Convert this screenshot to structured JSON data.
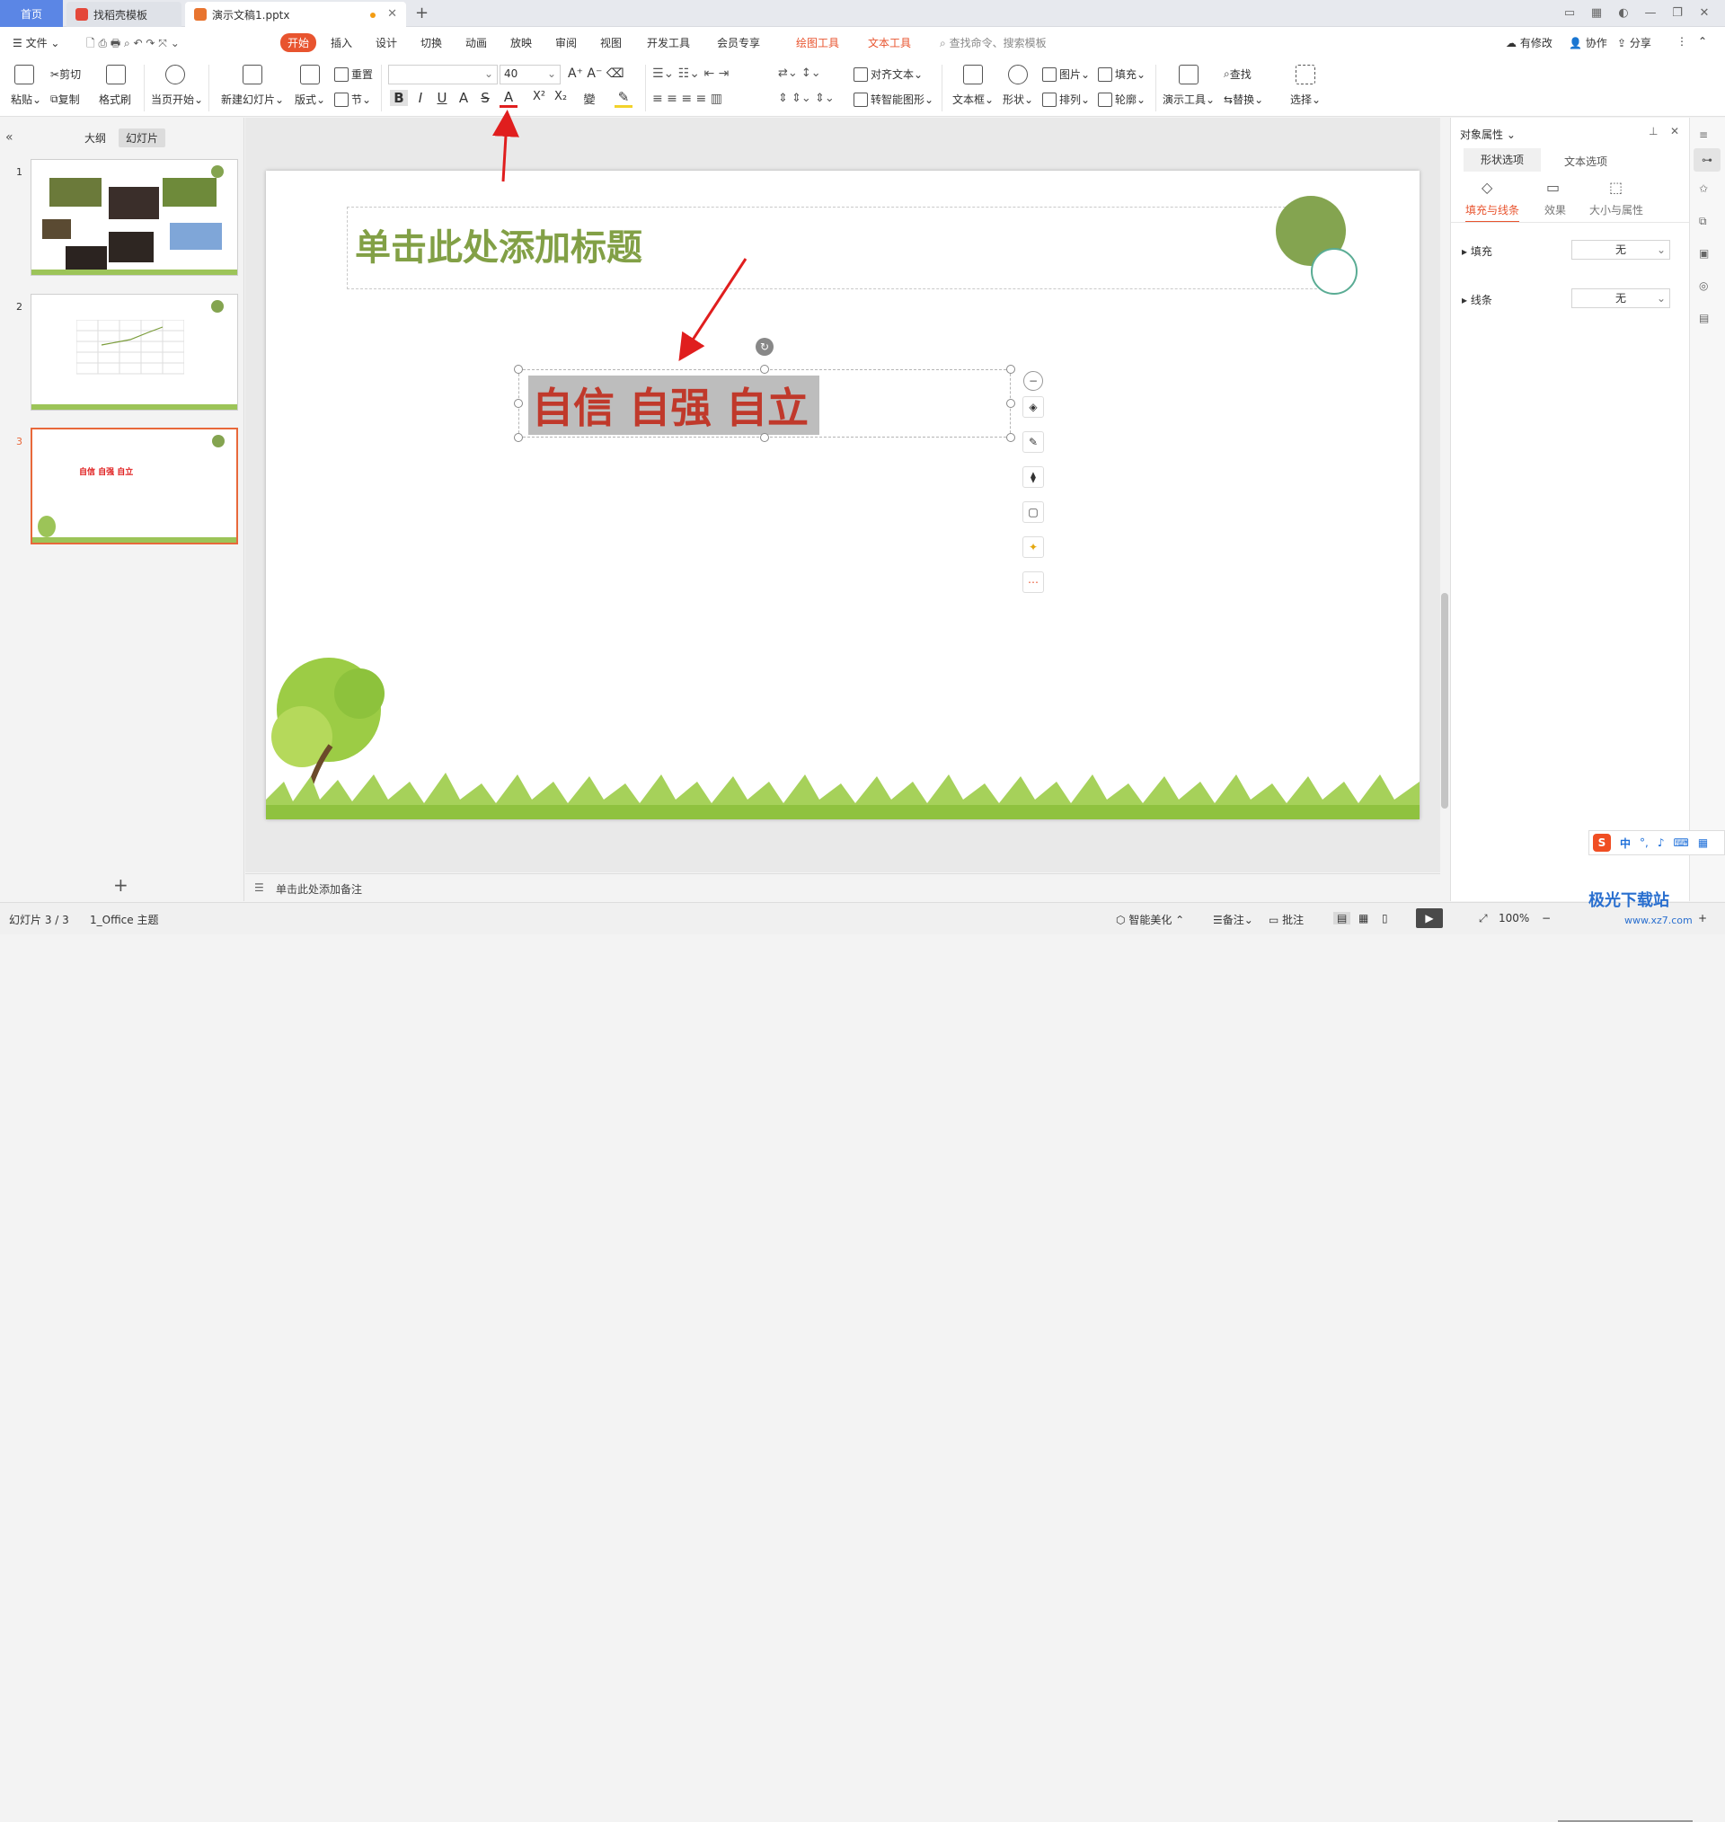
{
  "tabs": {
    "home": "首页",
    "template": "找稻壳模板",
    "doc": "演示文稿1.pptx"
  },
  "menu": {
    "file": "文件",
    "items": [
      "开始",
      "插入",
      "设计",
      "切换",
      "动画",
      "放映",
      "审阅",
      "视图",
      "开发工具",
      "会员专享"
    ],
    "drawing_tools": "绘图工具",
    "text_tools": "文本工具",
    "search_placeholder": "查找命令、搜索模板",
    "has_changes": "有修改",
    "collab": "协作",
    "share": "分享"
  },
  "ribbon": {
    "paste": "粘贴",
    "cut": "剪切",
    "copy": "复制",
    "format_painter": "格式刷",
    "from_current": "当页开始",
    "new_slide": "新建幻灯片",
    "layout": "版式",
    "section": "节",
    "reset": "重置",
    "font_size": "40",
    "align_text": "对齐文本",
    "smartart": "转智能图形",
    "textbox": "文本框",
    "shape": "形状",
    "picture": "图片",
    "arrange": "排列",
    "fill": "填充",
    "outline": "轮廓",
    "present_tools": "演示工具",
    "find": "查找",
    "replace": "替换",
    "select": "选择"
  },
  "left": {
    "outline_tab": "大纲",
    "slides_tab": "幻灯片",
    "slide_numbers": [
      "1",
      "2",
      "3"
    ],
    "thumb3_text": "自信 自强 自立"
  },
  "slide": {
    "title_placeholder": "单击此处添加标题",
    "body_text": "自信 自强 自立"
  },
  "notes_placeholder": "单击此处添加备注",
  "right": {
    "panel_title": "对象属性",
    "tab_shape": "形状选项",
    "tab_text": "文本选项",
    "sub_fill_line": "填充与线条",
    "sub_effect": "效果",
    "sub_size": "大小与属性",
    "fill_label": "填充",
    "fill_value": "无",
    "line_label": "线条",
    "line_value": "无"
  },
  "status": {
    "slide_info": "幻灯片 3 / 3",
    "theme": "1_Office 主题",
    "beautify": "智能美化",
    "notes": "备注",
    "comments": "批注",
    "zoom": "100%"
  },
  "ime": {
    "lang": "中"
  },
  "watermark": {
    "name": "极光下载站",
    "url": "www.xz7.com"
  },
  "colors": {
    "accent": "#e8542f",
    "title_green": "#82a046",
    "body_red": "#c0392b",
    "circle_green": "#84a450",
    "home_tab": "#5b86e5"
  }
}
